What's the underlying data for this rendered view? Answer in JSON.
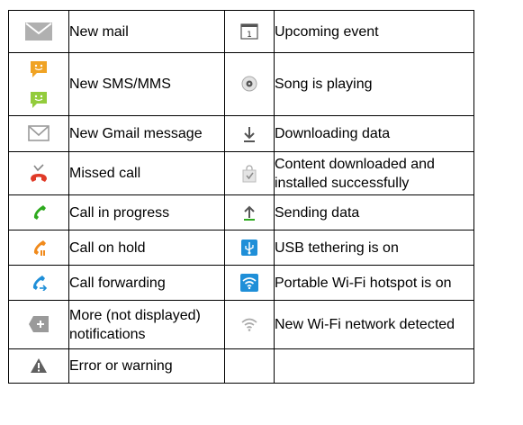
{
  "rows": [
    {
      "left": {
        "icon": "envelope-icon",
        "label": "New mail"
      },
      "right": {
        "icon": "calendar-icon",
        "label": "Upcoming event"
      }
    },
    {
      "left": {
        "icon": "sms-mms-icon",
        "label": "New SMS/MMS"
      },
      "right": {
        "icon": "music-disc-icon",
        "label": "Song is playing"
      }
    },
    {
      "left": {
        "icon": "gmail-icon",
        "label": "New Gmail message"
      },
      "right": {
        "icon": "download-arrow-icon",
        "label": "Downloading data"
      }
    },
    {
      "left": {
        "icon": "missed-call-icon",
        "label": "Missed call"
      },
      "right": {
        "icon": "installed-bag-icon",
        "label_lines": [
          "Content downloaded and",
          "installed successfully"
        ]
      }
    },
    {
      "left": {
        "icon": "call-in-progress-icon",
        "label": "Call in progress"
      },
      "right": {
        "icon": "upload-arrow-icon",
        "label": "Sending data"
      }
    },
    {
      "left": {
        "icon": "call-on-hold-icon",
        "label": "Call on hold"
      },
      "right": {
        "icon": "usb-icon",
        "label": "USB tethering is on"
      }
    },
    {
      "left": {
        "icon": "call-forwarding-icon",
        "label": "Call forwarding"
      },
      "right": {
        "icon": "wifi-hotspot-icon",
        "label": "Portable Wi-Fi hotspot is on"
      }
    },
    {
      "left": {
        "icon": "more-notifications-icon",
        "label_lines": [
          "More (not displayed)",
          "notifications"
        ]
      },
      "right": {
        "icon": "wifi-network-icon",
        "label": "New Wi-Fi network detected"
      }
    },
    {
      "left": {
        "icon": "warning-icon",
        "label": "Error or warning"
      },
      "right": null
    }
  ],
  "colors": {
    "phone_green": "#2eaa1e",
    "phone_red": "#e03a27",
    "phone_orange": "#f08a1c",
    "phone_blue": "#1f8fd8",
    "icon_grey": "#9a9a9a",
    "sms_orange": "#f0a324",
    "sms_green": "#93cc3c"
  }
}
